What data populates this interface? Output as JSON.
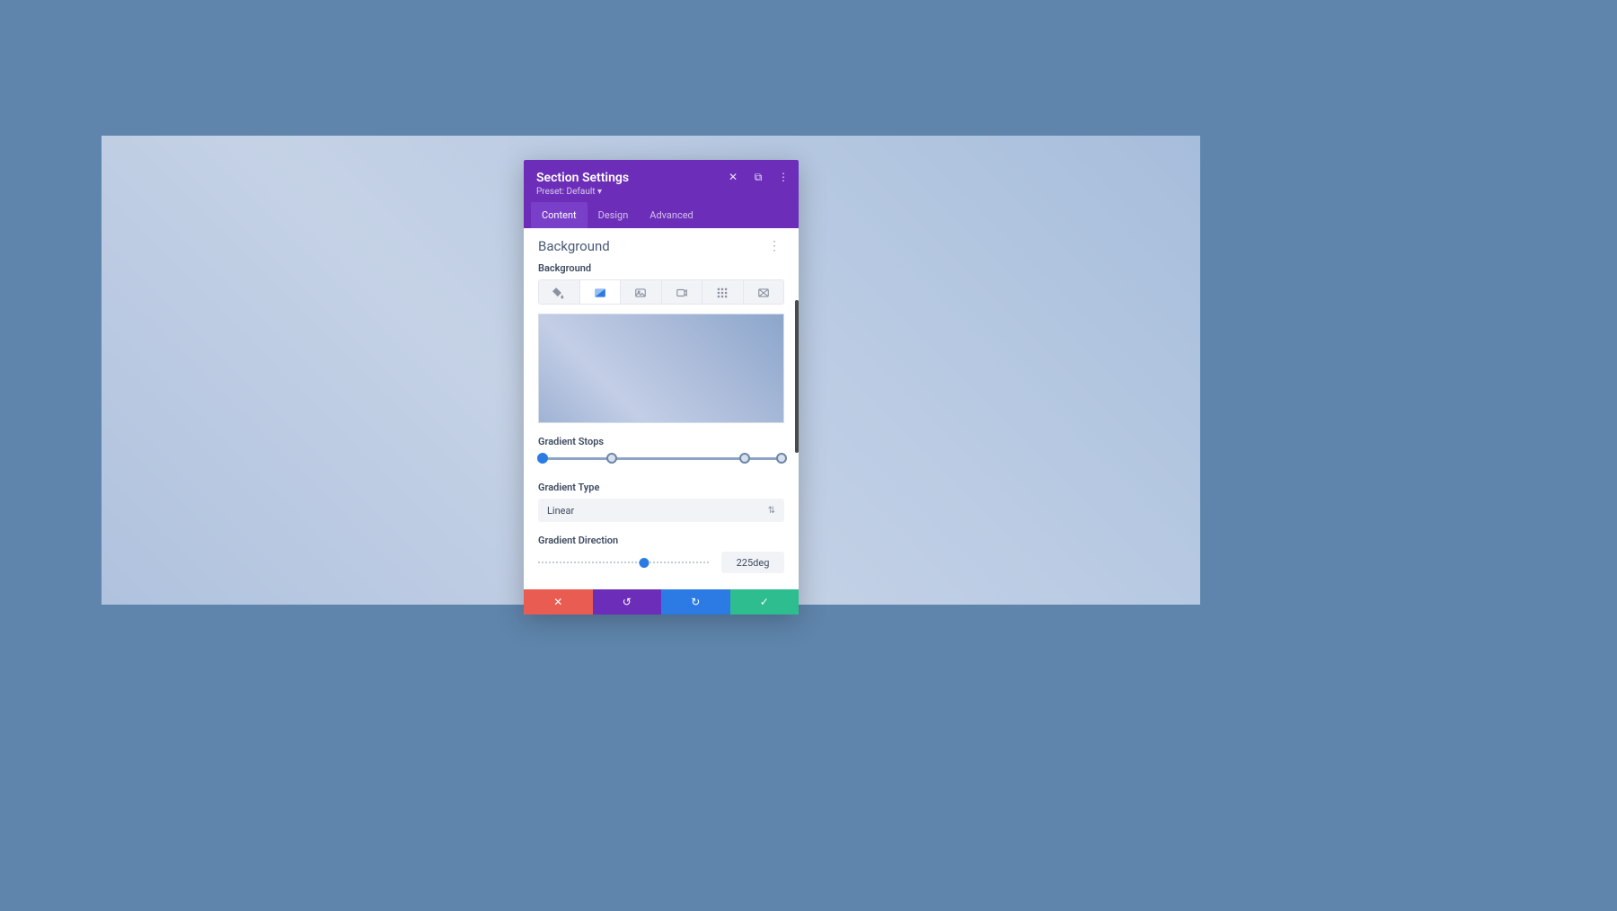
{
  "panel": {
    "title": "Section Settings",
    "preset_label": "Preset: Default ▾"
  },
  "tabs": {
    "content": "Content",
    "design": "Design",
    "advanced": "Advanced"
  },
  "section": {
    "title": "Background",
    "bg_label": "Background"
  },
  "stops": {
    "label": "Gradient Stops"
  },
  "gradient_type": {
    "label": "Gradient Type",
    "value": "Linear"
  },
  "direction": {
    "label": "Gradient Direction",
    "value": "225deg",
    "percent": 62
  },
  "icons": {
    "close": "✕",
    "copy": "⧉",
    "more": "⋮",
    "caret": "⇅",
    "cancel": "✕",
    "undo": "↺",
    "redo": "↻",
    "save": "✓"
  },
  "gradient_stops": [
    {
      "pos": 2,
      "active": true
    },
    {
      "pos": 30,
      "active": false
    },
    {
      "pos": 84,
      "active": false
    },
    {
      "pos": 99,
      "active": false
    }
  ]
}
